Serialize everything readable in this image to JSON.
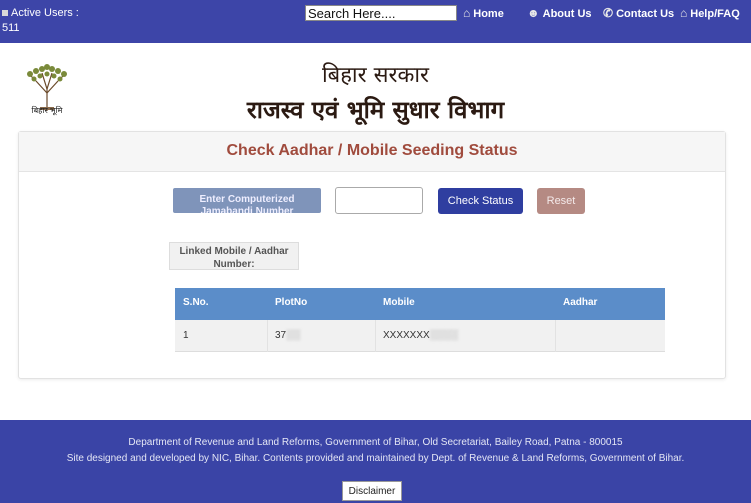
{
  "topbar": {
    "active_users_label": "Active Users :",
    "active_users_count": "511",
    "search_placeholder": "Search Here....",
    "nav": [
      {
        "label": "Home",
        "icon": "home-icon"
      },
      {
        "label": "About Us",
        "icon": "users-icon"
      },
      {
        "label": "Contact Us",
        "icon": "phone-icon"
      },
      {
        "label": "Help/FAQ",
        "icon": "help-icon"
      }
    ]
  },
  "header": {
    "logo_caption": "बिहार भूमि",
    "title_line1": "बिहार सरकार",
    "title_line2": "राजस्व एवं भूमि सुधार विभाग"
  },
  "panel": {
    "title": "Check Aadhar / Mobile Seeding Status",
    "computerized_label": "Enter Computerized Jamabandi Number",
    "input_value": "",
    "check_button": "Check Status",
    "reset_button": "Reset",
    "linked_label": "Linked Mobile / Aadhar Number:"
  },
  "table": {
    "headers": [
      "S.No.",
      "PlotNo",
      "Mobile",
      "Aadhar"
    ],
    "rows": [
      [
        "1",
        "37",
        "XXXXXXX",
        ""
      ]
    ]
  },
  "footer": {
    "line1": "Department of Revenue and Land Reforms, Government of Bihar, Old Secretariat, Bailey Road, Patna - 800015",
    "line2": "Site designed and developed by NIC, Bihar. Contents provided and maintained by Dept. of Revenue & Land Reforms, Government of Bihar.",
    "disclaimer": "Disclaimer"
  },
  "colors": {
    "topbar": "#3d45a8",
    "footer": "#3a44a6",
    "title_accent": "#a04b3d",
    "table_header": "#5b8dc9",
    "check_button": "#2f3ea0",
    "reset_button": "#b58a83"
  }
}
